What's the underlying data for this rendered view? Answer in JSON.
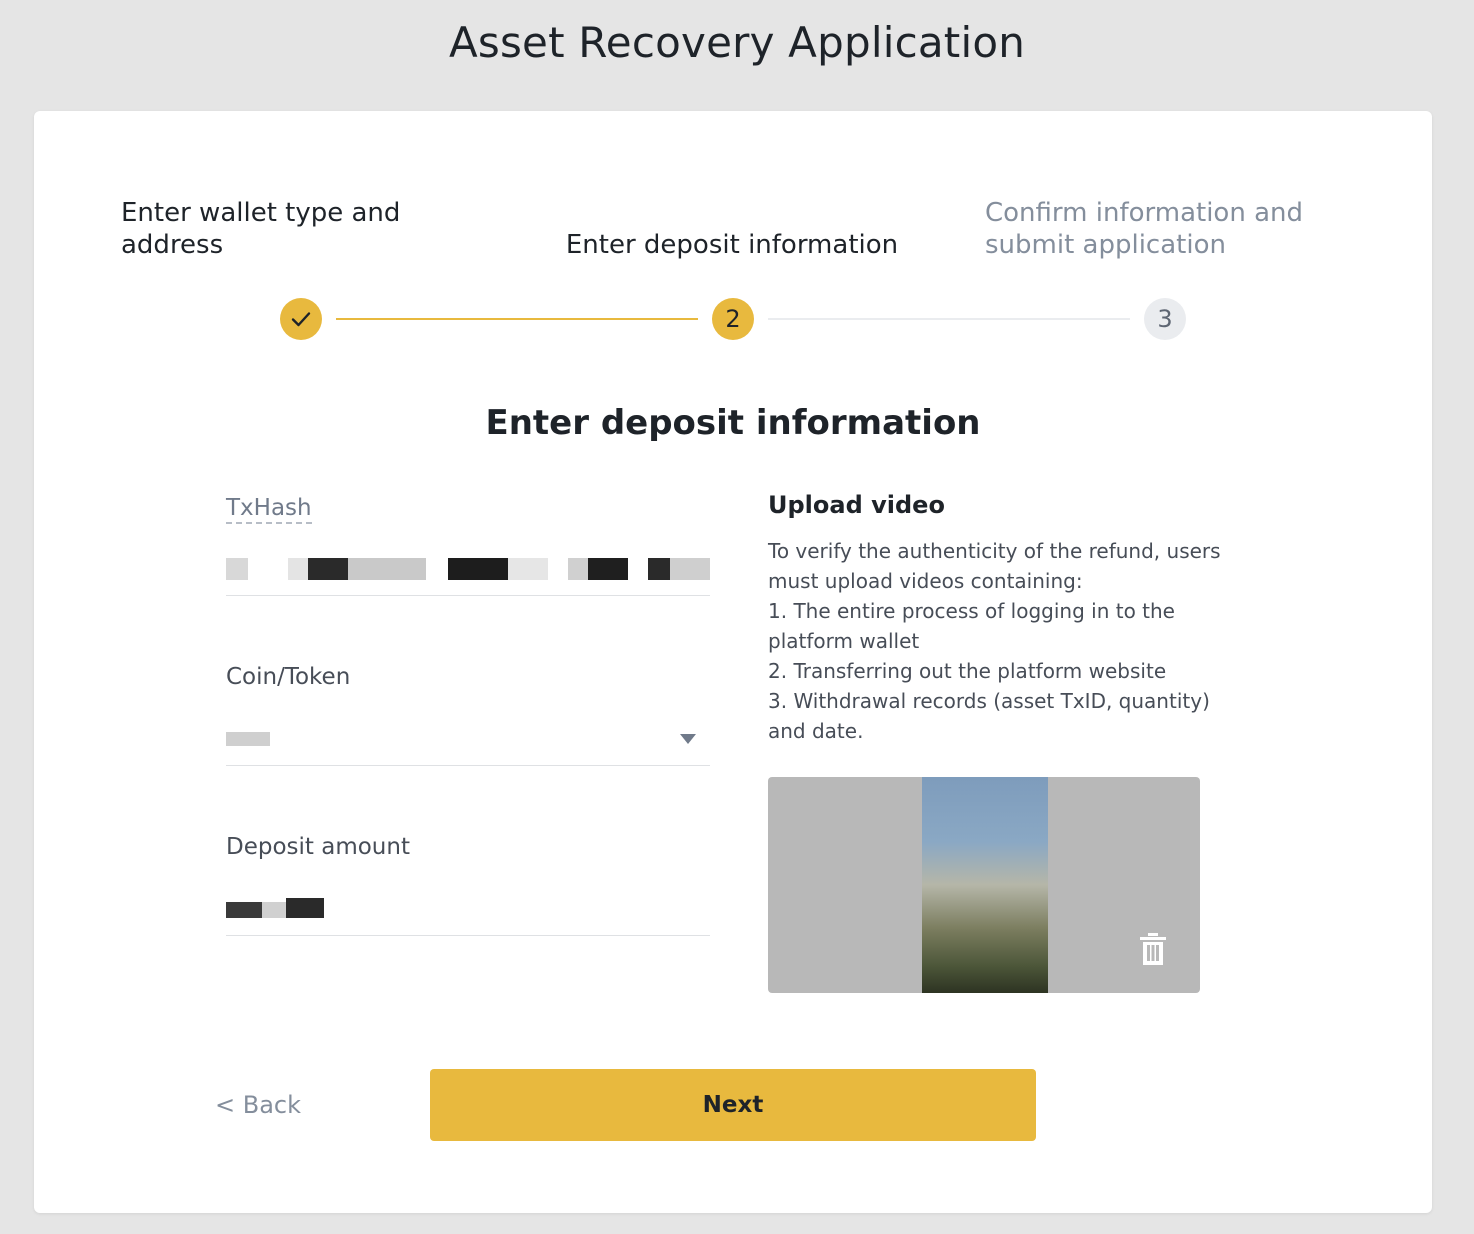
{
  "header": {
    "title": "Asset Recovery Application"
  },
  "stepper": {
    "steps": [
      {
        "label": "Enter wallet type and address",
        "status": "completed",
        "marker": ""
      },
      {
        "label": "Enter deposit information",
        "status": "current",
        "marker": "2"
      },
      {
        "label": "Confirm information and submit application",
        "status": "upcoming",
        "marker": "3"
      }
    ]
  },
  "form": {
    "title": "Enter deposit information",
    "txhash": {
      "label": "TxHash",
      "value": ""
    },
    "coin": {
      "label": "Coin/Token",
      "value": ""
    },
    "amount": {
      "label": "Deposit amount",
      "value": ""
    }
  },
  "upload": {
    "title": "Upload video",
    "description": "To verify the authenticity of the refund, users must upload videos containing:\n 1. The entire process of logging in to the platform wallet\n 2. Transferring out the platform website\n 3. Withdrawal records (asset TxID, quantity) and date."
  },
  "footer": {
    "back_label": "< Back",
    "next_label": "Next"
  },
  "colors": {
    "accent": "#e8b93e",
    "muted": "#848e9c",
    "text": "#1e2329"
  }
}
